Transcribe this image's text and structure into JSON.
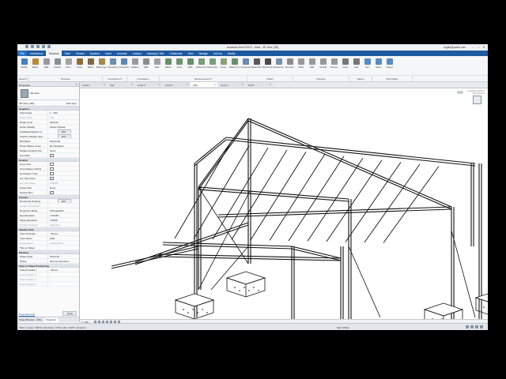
{
  "window": {
    "title": "Autodesk Revit 2020.2 - Arbre - 3D View: {3D}",
    "user": "tegrite@yahoo.com",
    "controls": [
      "–",
      "□",
      "✕"
    ]
  },
  "ribbon": {
    "tabs": [
      "File",
      "Architecture",
      "Structure",
      "Steel",
      "Precast",
      "Systems",
      "Insert",
      "Annotate",
      "Analyze",
      "Massing & Site",
      "Collaborate",
      "View",
      "Manage",
      "Add-Ins",
      "Modify"
    ],
    "active_tab": "Structure",
    "tools": [
      {
        "label": "Modify",
        "icon": "cursor-icon",
        "color": "#4a7fc1"
      },
      {
        "label": "Beam",
        "icon": "beam-icon",
        "color": "#b98a3c"
      },
      {
        "label": "Wall",
        "icon": "wall-icon",
        "color": "#9a9a9a"
      },
      {
        "label": "Column",
        "icon": "column-icon",
        "color": "#8a8f96"
      },
      {
        "label": "Floor",
        "icon": "floor-icon",
        "color": "#a5a5a5"
      },
      {
        "label": "Truss",
        "icon": "truss-icon",
        "color": "#8b6f3e"
      },
      {
        "label": "Brace",
        "icon": "brace-icon",
        "color": "#7b6a45"
      },
      {
        "label": "Beam System",
        "icon": "beam-system-icon",
        "color": "#a48a4d"
      },
      {
        "label": "Connection",
        "icon": "connection-icon",
        "color": "#6f8fa8"
      },
      {
        "label": "Connection Automation",
        "icon": "automation-icon",
        "color": "#5f86b3"
      },
      {
        "label": "Isolated",
        "icon": "isolated-icon",
        "color": "#9b9b9b"
      },
      {
        "label": "Wall",
        "icon": "wall-foundation-icon",
        "color": "#8d8d8d"
      },
      {
        "label": "Slab",
        "icon": "slab-icon",
        "color": "#a2a2a2"
      },
      {
        "label": "Rebar",
        "icon": "rebar-icon",
        "color": "#6b8e6b"
      },
      {
        "label": "Area",
        "icon": "area-rebar-icon",
        "color": "#709670"
      },
      {
        "label": "Path",
        "icon": "path-rebar-icon",
        "color": "#6b8e6b"
      },
      {
        "label": "Fabric Area",
        "icon": "fabric-icon",
        "color": "#7a9c7a"
      },
      {
        "label": "Fabric Sheet",
        "icon": "fabric-sheet-icon",
        "color": "#7a9c7a"
      },
      {
        "label": "Cover",
        "icon": "cover-icon",
        "color": "#8aa37a"
      },
      {
        "label": "Rebar Coupler",
        "icon": "coupler-icon",
        "color": "#6b8e6b"
      },
      {
        "label": "Component",
        "icon": "component-icon",
        "color": "#6c8ab0"
      },
      {
        "label": "Model Text",
        "icon": "model-text-icon",
        "color": "#5b5b5b"
      },
      {
        "label": "Model Line",
        "icon": "model-line-icon",
        "color": "#4a4a4a"
      },
      {
        "label": "Model Group",
        "icon": "model-group-icon",
        "color": "#7a8fa8"
      },
      {
        "label": "By Face",
        "icon": "by-face-icon",
        "color": "#8c8c8c"
      },
      {
        "label": "Shaft",
        "icon": "shaft-icon",
        "color": "#999"
      },
      {
        "label": "Wall",
        "icon": "wall-opening-icon",
        "color": "#999"
      },
      {
        "label": "Vertical",
        "icon": "vertical-opening-icon",
        "color": "#999"
      },
      {
        "label": "Dormer",
        "icon": "dormer-icon",
        "color": "#999"
      },
      {
        "label": "Level",
        "icon": "level-icon",
        "color": "#777"
      },
      {
        "label": "Grid",
        "icon": "grid-icon",
        "color": "#777"
      },
      {
        "label": "Set",
        "icon": "set-icon",
        "color": "#5b8bc0"
      },
      {
        "label": "Show",
        "icon": "show-icon",
        "color": "#5b8bc0"
      },
      {
        "label": "Viewer",
        "icon": "viewer-icon",
        "color": "#5b8bc0"
      }
    ],
    "panels": [
      {
        "label": "Select ▾",
        "width": 14
      },
      {
        "label": "Structure",
        "width": 92
      },
      {
        "label": "Connection ▾",
        "width": 30
      },
      {
        "label": "Foundation",
        "width": 40
      },
      {
        "label": "Reinforcement ▾",
        "width": 110
      },
      {
        "label": "Model",
        "width": 57
      },
      {
        "label": "Opening",
        "width": 70
      },
      {
        "label": "Datum",
        "width": 28
      },
      {
        "label": "Work Plane",
        "width": 50
      }
    ]
  },
  "view_tabs": [
    {
      "label": "Level 1",
      "active": false
    },
    {
      "label": "Sud",
      "active": false
    },
    {
      "label": "Level 2",
      "active": false
    },
    {
      "label": "Level 3",
      "active": false
    },
    {
      "label": "{3D}",
      "active": true
    },
    {
      "label": "Level 2",
      "active": false
    },
    {
      "label": "North",
      "active": false
    }
  ],
  "properties": {
    "title": "Properties",
    "close": "✕",
    "type_name": "3D View",
    "filter_left": "3D View: {3D}",
    "filter_right": "Edit Type",
    "groups": [
      {
        "name": "Graphics",
        "rows": [
          {
            "k": "View Scale",
            "v": "1 : 100"
          },
          {
            "k": "Scale Value",
            "v": "100",
            "dim": true
          },
          {
            "k": "Detail Level",
            "v": "Medium"
          },
          {
            "k": "Parts Visibility",
            "v": "Show Original"
          },
          {
            "k": "Visibility/Graphics O...",
            "v": "Edit...",
            "btn": true
          },
          {
            "k": "Graphic Display Opti...",
            "v": "Edit...",
            "btn": true
          },
          {
            "k": "Discipline",
            "v": "Structural"
          },
          {
            "k": "Show Hidden Lines",
            "v": "By Discipline"
          },
          {
            "k": "Default Analysis Dis...",
            "v": "None"
          },
          {
            "k": "Sun Path",
            "v": "",
            "cb": true
          }
        ]
      },
      {
        "name": "Extents",
        "rows": [
          {
            "k": "Crop View",
            "v": "",
            "cb": true
          },
          {
            "k": "Crop Region Visible",
            "v": "",
            "cb": true
          },
          {
            "k": "Annotation Crop",
            "v": "",
            "cb": true
          },
          {
            "k": "Far Clip Active",
            "v": "",
            "cb": true
          },
          {
            "k": "Far Clip Offset",
            "v": "304800",
            "dim": true
          },
          {
            "k": "Scope Box",
            "v": "None"
          },
          {
            "k": "Section Box",
            "v": "",
            "cb": true
          }
        ]
      },
      {
        "name": "Camera",
        "rows": [
          {
            "k": "Rendering Settings",
            "v": "Edit...",
            "btn": true
          },
          {
            "k": "Locked Orientation",
            "v": "",
            "dim": true
          },
          {
            "k": "Projection Mode",
            "v": "Orthographic"
          },
          {
            "k": "Eye Elevation",
            "v": "7.00415"
          },
          {
            "k": "Target Elevation",
            "v": "3.0065"
          },
          {
            "k": "Camera Position",
            "v": "Adjusting",
            "dim": true
          }
        ]
      },
      {
        "name": "Identity Data",
        "rows": [
          {
            "k": "View Template",
            "v": "<None>"
          },
          {
            "k": "View Name",
            "v": "{3D}"
          },
          {
            "k": "Dependency",
            "v": "Independent",
            "dim": true
          },
          {
            "k": "Title on Sheet",
            "v": ""
          }
        ]
      },
      {
        "name": "Phasing",
        "rows": [
          {
            "k": "Phase Filter",
            "v": "Show All"
          },
          {
            "k": "Phase",
            "v": "New Construction"
          }
        ]
      },
      {
        "name": "View to Sheet Positioning",
        "rows": [
          {
            "k": "Saved Position",
            "v": "<None>"
          },
          {
            "k": "New Position X",
            "v": "",
            "dim": true
          },
          {
            "k": "New Position Y",
            "v": "",
            "dim": true
          },
          {
            "k": "New Position Z",
            "v": "",
            "dim": true
          }
        ]
      }
    ],
    "help_link": "Properties help",
    "apply": "Apply",
    "bottom_tabs": [
      "Project Browser - Arbre",
      "Properties"
    ],
    "active_bottom_tab": "Properties"
  },
  "viewcube": {
    "label_line1": "Autodesk Graphics",
    "label_line2": "Tech Preview"
  },
  "view_control": {
    "scale": "1 : 100"
  },
  "status": {
    "text": "Click to select, TAB for alternates, CTRL adds, SHIFT unselects.",
    "model": "Main Model"
  }
}
